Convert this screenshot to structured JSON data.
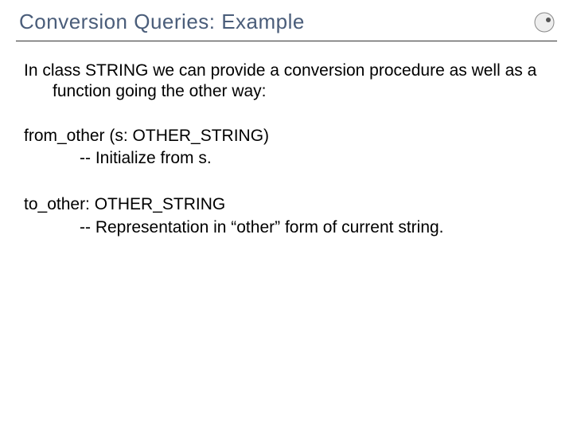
{
  "title": "Conversion Queries: Example",
  "intro": "In class STRING we can provide a conversion procedure as well as a function going the other way:",
  "proc": {
    "signature": "from_other (s: OTHER_STRING)",
    "comment": "-- Initialize from s."
  },
  "func": {
    "signature": "to_other: OTHER_STRING",
    "comment": "-- Representation in “other” form of current string."
  },
  "logo_alt": "chair-of-software-engineering-logo"
}
